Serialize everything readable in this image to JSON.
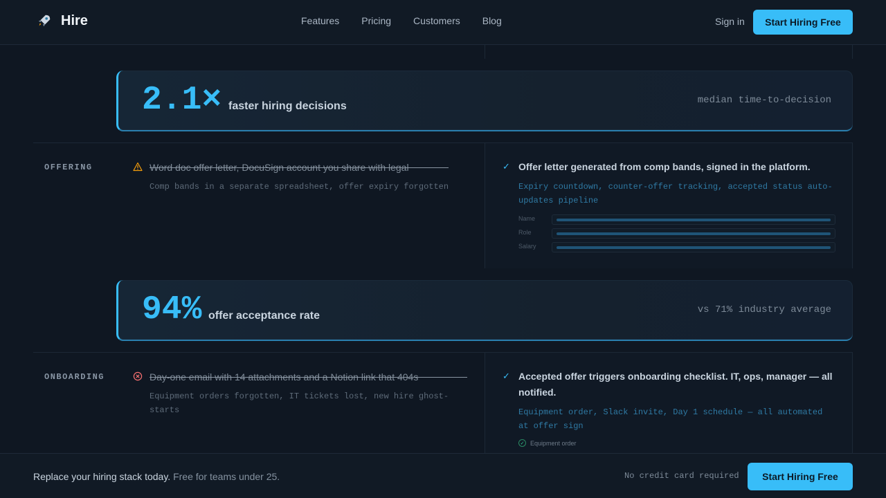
{
  "header": {
    "brand": "Hire",
    "nav": [
      "Features",
      "Pricing",
      "Customers",
      "Blog"
    ],
    "signin": "Sign in",
    "cta": "Start Hiring Free"
  },
  "stats": [
    {
      "number": "2.1×",
      "label": "faster hiring decisions",
      "note": "median time-to-decision"
    },
    {
      "number": "94%",
      "label": "offer acceptance rate",
      "note": "vs 71% industry average"
    }
  ],
  "sections": [
    {
      "label": "OFFERING",
      "old_title": "Word doc offer letter, DocuSign account you share with legal",
      "old_sub": "Comp bands in a separate spreadsheet, offer expiry forgotten",
      "new_title": "Offer letter generated from comp bands, signed in the platform.",
      "new_sub": "Expiry countdown, counter-offer tracking, accepted status auto-updates pipeline",
      "form_fields": [
        "Name",
        "Role",
        "Salary"
      ]
    },
    {
      "label": "ONBOARDING",
      "old_title": "Day-one email with 14 attachments and a Notion link that 404s",
      "old_sub": "Equipment orders forgotten, IT tickets lost, new hire ghost-starts",
      "new_title": "Accepted offer triggers onboarding checklist. IT, ops, manager — all notified.",
      "new_sub": "Equipment order, Slack invite, Day 1 schedule — all automated at offer sign",
      "checklist": [
        "Equipment order"
      ]
    }
  ],
  "footer": {
    "text": "Replace your hiring stack today.",
    "text_muted": "Free for teams under 25.",
    "note": "No credit card required",
    "cta": "Start Hiring Free"
  },
  "colors": {
    "accent": "#38bdf8",
    "background": "#0f1722",
    "warning": "#f59e0b",
    "error": "#f87171",
    "success": "#34d399"
  }
}
